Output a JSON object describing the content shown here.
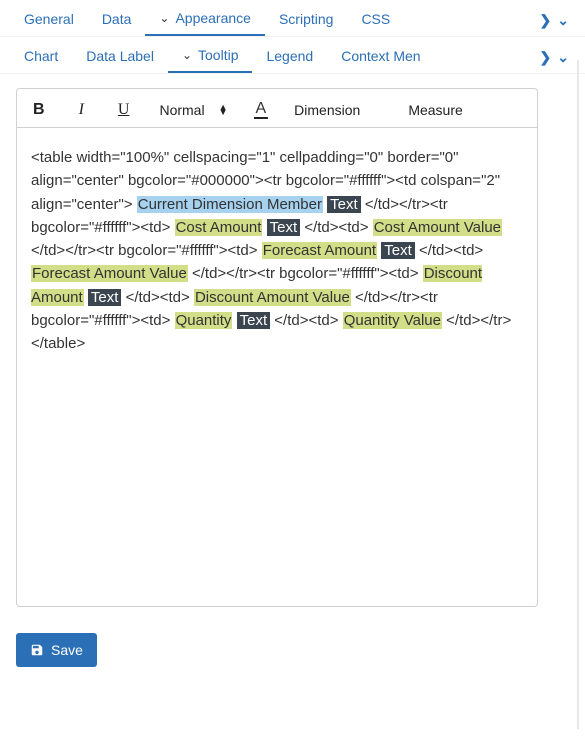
{
  "tabs_top": {
    "general": "General",
    "data": "Data",
    "appearance": "Appearance",
    "scripting": "Scripting",
    "css": "CSS"
  },
  "tabs_sub": {
    "chart": "Chart",
    "data_label": "Data Label",
    "tooltip": "Tooltip",
    "legend": "Legend",
    "context_menu": "Context Men"
  },
  "toolbar": {
    "bold": "B",
    "italic": "I",
    "underline": "U",
    "format_select": "Normal",
    "color_btn": "A",
    "dimension_btn": "Dimension",
    "measure_btn": "Measure"
  },
  "editor": {
    "line1": "<table width=\"100%\" cellspacing=\"1\" cellpadding=\"0\" border=\"0\" align=\"center\" bgcolor=\"#000000\"><tr bgcolor=\"#ffffff\"><td colspan=\"2\" align=\"center\">",
    "token_dim_member": "Current Dimension Member",
    "token_text": "Text",
    "seg_close1": " </td></tr><tr bgcolor=\"#ffffff\"><td> ",
    "token_cost_amount": "Cost Amount",
    "seg_close2": "</td><td>",
    "token_cost_amount_value": "Cost Amount Value",
    "seg_close3": " </td></tr><tr bgcolor=\"#ffffff\"><td> ",
    "token_forecast_amount": "Forecast Amount",
    "seg_close4": " </td><td>",
    "token_forecast_amount_value": "Forecast Amount Value",
    "seg_close5": " </td></tr><tr bgcolor=\"#ffffff\"><td> ",
    "token_discount_amount": "Discount Amount",
    "seg_close6": " </td><td>",
    "token_discount_amount_value": "Discount Amount Value",
    "seg_close7": " </td></tr><tr bgcolor=\"#ffffff\"><td> ",
    "token_quantity": "Quantity",
    "seg_close8": "  </td><td> ",
    "token_quantity_value": "Quantity Value",
    "seg_close9": " </td></tr></table>"
  },
  "save_label": "Save"
}
